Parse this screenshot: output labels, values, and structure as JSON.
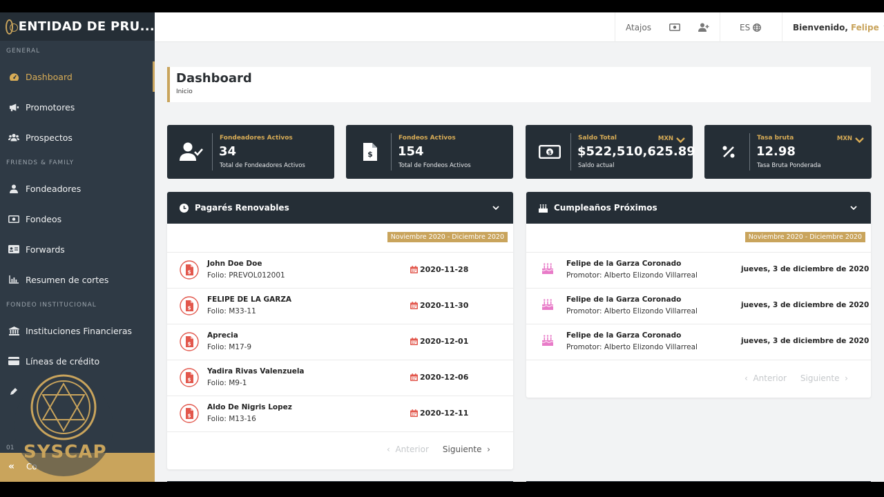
{
  "brand": {
    "name": "ENTIDAD DE PRU...",
    "watermark": "SYSCAP"
  },
  "sidebar": {
    "sections": [
      "GENERAL",
      "FRIENDS & FAMILY",
      "FONDEO INSTITUCIONAL"
    ],
    "items": [
      {
        "label": "Dashboard",
        "icon": "gauge-icon"
      },
      {
        "label": "Promotores",
        "icon": "megaphone-icon"
      },
      {
        "label": "Prospectos",
        "icon": "users-icon"
      },
      {
        "label": "Fondeadores",
        "icon": "user-icon"
      },
      {
        "label": "Fondeos",
        "icon": "money-icon"
      },
      {
        "label": "Forwards",
        "icon": "id-card-icon"
      },
      {
        "label": "Resumen de cortes",
        "icon": "bar-chart-icon"
      },
      {
        "label": "Instituciones Financieras",
        "icon": "bank-icon"
      },
      {
        "label": "Líneas de crédito",
        "icon": "credit-card-icon"
      }
    ],
    "bottom_num": "01",
    "collapse_label": "Co"
  },
  "topbar": {
    "shortcuts": "Atajos",
    "lang": "ES",
    "welcome": "Bienvenido,",
    "user": "Felipe"
  },
  "page": {
    "title": "Dashboard",
    "crumb": "Inicio"
  },
  "stats": [
    {
      "label": "Fondeadores Activos",
      "value": "34",
      "sub": "Total de Fondeadores Activos",
      "currency": ""
    },
    {
      "label": "Fondeos Activos",
      "value": "154",
      "sub": "Total de Fondeos Activos",
      "currency": ""
    },
    {
      "label": "Saldo Total",
      "value": "$522,510,625.89",
      "sub": "Saldo actual",
      "currency": "MXN"
    },
    {
      "label": "Tasa bruta",
      "value": "12.98",
      "sub": "Tasa Bruta Ponderada",
      "currency": "MXN"
    }
  ],
  "pagares": {
    "title": "Pagarés Renovables",
    "range": "Noviembre 2020 - Diciembre 2020",
    "rows": [
      {
        "name": "John Doe Doe",
        "folio": "Folio: PREVOL012001",
        "date": "2020-11-28"
      },
      {
        "name": "FELIPE DE LA GARZA",
        "folio": "Folio: M33-11",
        "date": "2020-11-30"
      },
      {
        "name": "Aprecia",
        "folio": "Folio: M17-9",
        "date": "2020-12-01"
      },
      {
        "name": "Yadira Rivas Valenzuela",
        "folio": "Folio: M9-1",
        "date": "2020-12-06"
      },
      {
        "name": "Aldo De Nigris Lopez",
        "folio": "Folio: M13-16",
        "date": "2020-12-11"
      }
    ],
    "prev": "Anterior",
    "next": "Siguiente"
  },
  "cumple": {
    "title": "Cumpleaños Próximos",
    "range": "Noviembre 2020 - Diciembre 2020",
    "rows": [
      {
        "name": "Felipe de la Garza Coronado",
        "promotor": "Promotor: Alberto Elizondo Villarreal",
        "date": "jueves, 3 de diciembre de 2020"
      },
      {
        "name": "Felipe de la Garza Coronado",
        "promotor": "Promotor: Alberto Elizondo Villarreal",
        "date": "jueves, 3 de diciembre de 2020"
      },
      {
        "name": "Felipe de la Garza Coronado",
        "promotor": "Promotor: Alberto Elizondo Villarreal",
        "date": "jueves, 3 de diciembre de 2020"
      }
    ],
    "prev": "Anterior",
    "next": "Siguiente"
  },
  "colors": {
    "accent": "#c9a45c",
    "dark": "#252e36",
    "sidebar": "#2f3a45",
    "danger": "#e2574c",
    "pink": "#e87bc8"
  }
}
